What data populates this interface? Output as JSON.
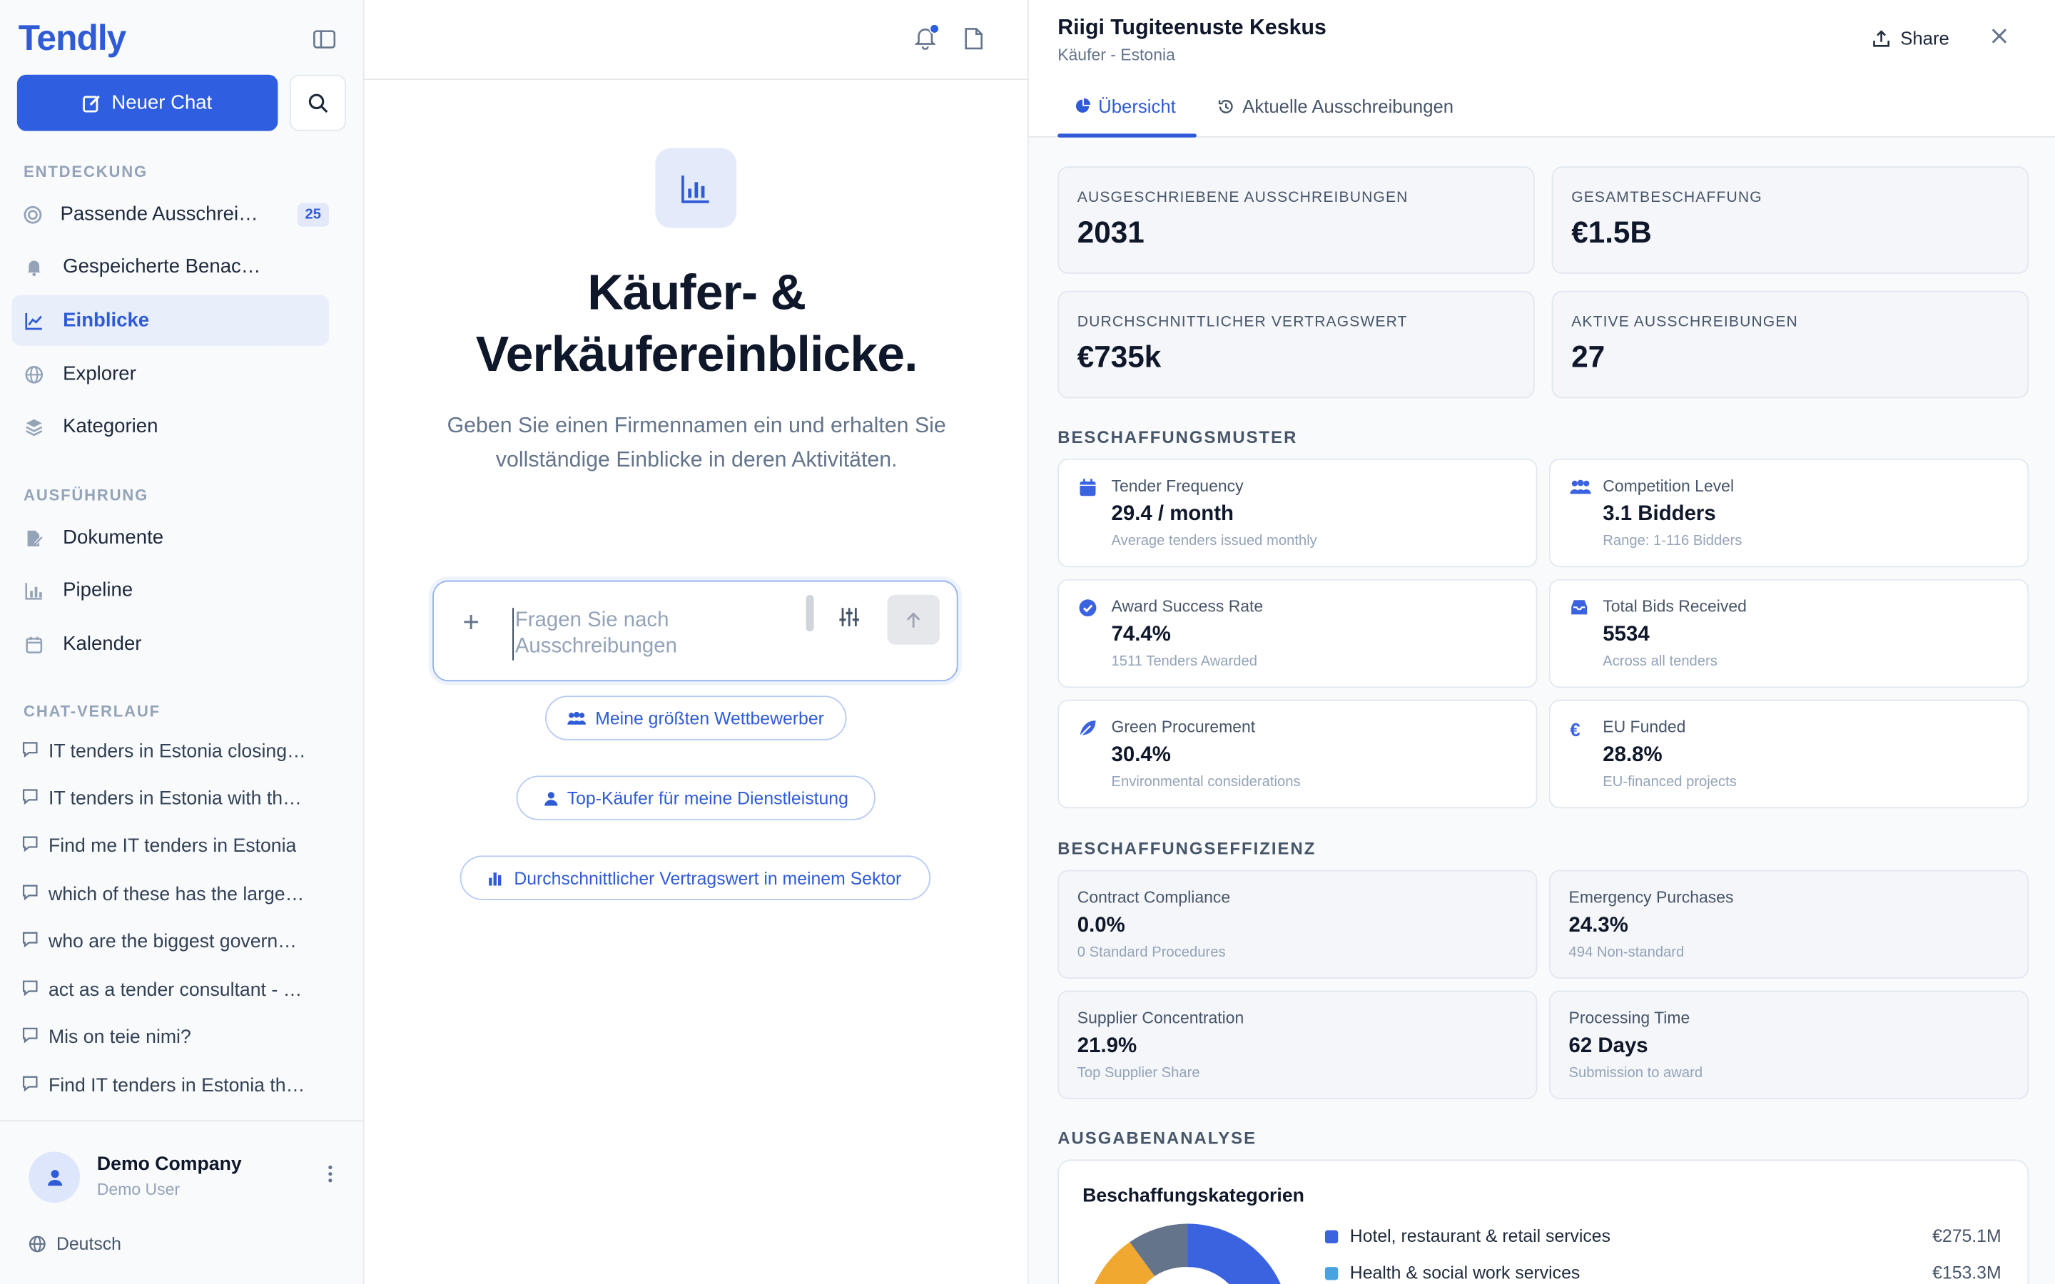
{
  "app": {
    "logo": "Tendly"
  },
  "sidebar": {
    "new_chat": "Neuer Chat",
    "sections": {
      "discovery": "ENTDECKUNG",
      "execution": "AUSFÜHRUNG",
      "history": "CHAT-VERLAUF"
    },
    "discovery_items": [
      {
        "label": "Passende Ausschreibungen",
        "badge": "25",
        "icon": "target-icon"
      },
      {
        "label": "Gespeicherte Benachrichtigungen",
        "icon": "bell-icon"
      },
      {
        "label": "Einblicke",
        "icon": "chart-line-icon",
        "active": true
      },
      {
        "label": "Explorer",
        "icon": "globe-icon"
      },
      {
        "label": "Kategorien",
        "icon": "layers-icon"
      }
    ],
    "execution_items": [
      {
        "label": "Dokumente",
        "icon": "file-edit-icon"
      },
      {
        "label": "Pipeline",
        "icon": "bar-chart-icon"
      },
      {
        "label": "Kalender",
        "icon": "calendar-icon"
      }
    ],
    "history": [
      "IT tenders in Estonia closing soon",
      "IT tenders in Estonia with the highest value",
      "Find me IT tenders in Estonia",
      "which of these has the largest budget",
      "who are the biggest government buyers",
      "act as a tender consultant - review",
      "Mis on teie nimi?",
      "Find IT tenders in Estonia this month"
    ],
    "footer": {
      "company": "Demo Company",
      "user": "Demo User",
      "language": "Deutsch"
    }
  },
  "middle": {
    "title": "Käufer- & Verkäufereinblicke.",
    "subtitle": "Geben Sie einen Firmennamen ein und erhalten Sie vollständige Einblicke in deren Aktivitäten.",
    "input_placeholder": "Fragen Sie nach Ausschreibungen",
    "suggestions": [
      "Meine größten Wettbewerber",
      "Top-Käufer für meine Dienstleistung",
      "Durchschnittlicher Vertragswert in meinem Sektor"
    ]
  },
  "panel": {
    "title": "Riigi Tugiteenuste Keskus",
    "subtitle": "Käufer - Estonia",
    "share": "Share",
    "tabs": [
      "Übersicht",
      "Aktuelle Ausschreibungen"
    ],
    "stats": [
      {
        "label": "AUSGESCHRIEBENE AUSSCHREIBUNGEN",
        "value": "2031"
      },
      {
        "label": "GESAMTBESCHAFFUNG",
        "value": "€1.5B"
      },
      {
        "label": "DURCHSCHNITTLICHER VERTRAGSWERT",
        "value": "€735k"
      },
      {
        "label": "AKTIVE AUSSCHREIBUNGEN",
        "value": "27"
      }
    ],
    "patterns_title": "BESCHAFFUNGSMUSTER",
    "patterns": [
      {
        "label": "Tender Frequency",
        "value": "29.4 / month",
        "sub": "Average tenders issued monthly",
        "icon": "calendar-icon"
      },
      {
        "label": "Competition Level",
        "value": "3.1 Bidders",
        "sub": "Range: 1-116 Bidders",
        "icon": "users-icon"
      },
      {
        "label": "Award Success Rate",
        "value": "74.4%",
        "sub": "1511 Tenders Awarded",
        "icon": "check-circle-icon"
      },
      {
        "label": "Total Bids Received",
        "value": "5534",
        "sub": "Across all tenders",
        "icon": "inbox-icon"
      },
      {
        "label": "Green Procurement",
        "value": "30.4%",
        "sub": "Environmental considerations",
        "icon": "leaf-icon"
      },
      {
        "label": "EU Funded",
        "value": "28.8%",
        "sub": "EU-financed projects",
        "icon": "euro-icon"
      }
    ],
    "efficiency_title": "BESCHAFFUNGSEFFIZIENZ",
    "efficiency": [
      {
        "label": "Contract Compliance",
        "value": "0.0%",
        "sub": "0 Standard Procedures"
      },
      {
        "label": "Emergency Purchases",
        "value": "24.3%",
        "sub": "494 Non-standard"
      },
      {
        "label": "Supplier Concentration",
        "value": "21.9%",
        "sub": "Top Supplier Share"
      },
      {
        "label": "Processing Time",
        "value": "62 Days",
        "sub": "Submission to award"
      }
    ],
    "spend_title": "AUSGABENANALYSE",
    "spend_card_title": "Beschaffungskategorien",
    "categories": [
      {
        "name": "Hotel, restaurant & retail services",
        "amount": "€275.1M",
        "color": "#3b63e0"
      },
      {
        "name": "Health & social work services",
        "amount": "€153.3M",
        "color": "#4aa3df"
      }
    ]
  },
  "colors": {
    "accent": "#2f5fe0",
    "donut_gray": "#64748b",
    "donut_orange": "#f0a830"
  }
}
